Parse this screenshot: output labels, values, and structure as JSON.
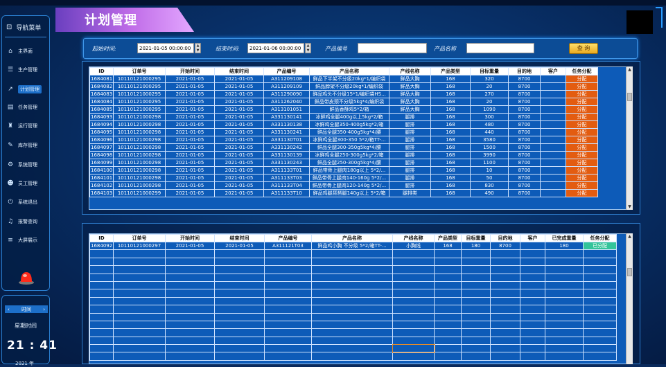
{
  "page": {
    "title": "计划管理"
  },
  "sidebar": {
    "header": "导航菜单",
    "items": [
      {
        "label": "主界面",
        "icon": "home-icon",
        "glyph": "⌂"
      },
      {
        "label": "生产管理",
        "icon": "list-icon",
        "glyph": "☰"
      },
      {
        "label": "计划管理",
        "icon": "chart-icon",
        "glyph": "↗",
        "active": true
      },
      {
        "label": "任务管理",
        "icon": "document-icon",
        "glyph": "▤"
      },
      {
        "label": "运行管理",
        "icon": "network-icon",
        "glyph": "♜"
      },
      {
        "label": "库存管理",
        "icon": "edit-icon",
        "glyph": "✎"
      },
      {
        "label": "系统管理",
        "icon": "gear-icon",
        "glyph": "⚙"
      },
      {
        "label": "员工管理",
        "icon": "user-card-icon",
        "glyph": "☻"
      },
      {
        "label": "系统退出",
        "icon": "power-icon",
        "glyph": "⏻"
      },
      {
        "label": "报警查询",
        "icon": "bell-icon",
        "glyph": "♫"
      },
      {
        "label": "大屏展示",
        "icon": "menu-icon",
        "glyph": "≡"
      }
    ]
  },
  "time_panel": {
    "header": "时间",
    "weekday": "星期时间",
    "clock": "21 : 41",
    "year": "2021 年"
  },
  "filter": {
    "start_label": "起始时间:",
    "start_value": "2021-01-05 00:00:00",
    "end_label": "结束时间:",
    "end_value": "2021-01-06 00:00:00",
    "code_label": "产品编号",
    "code_value": "",
    "name_label": "产品名称",
    "name_value": "",
    "query_label": "查 询"
  },
  "plan_table": {
    "columns": [
      "ID",
      "订单号",
      "开始时间",
      "结束时间",
      "产品编号",
      "产品名称",
      "产线名称",
      "产品类型",
      "目标重量",
      "目的地",
      "客户",
      "任务分配"
    ],
    "rows": [
      [
        "1684081",
        "10110121000295",
        "2021-01-05",
        "2021-01-05",
        "A311209108",
        "鲜品下半架不分级20kg*1/编织袋",
        "鲜品大胸",
        "168",
        "320",
        "8700",
        "",
        "分配"
      ],
      [
        "1684082",
        "10110121000295",
        "2021-01-05",
        "2021-01-05",
        "A311209109",
        "鲜品脖架不分级20kg*1/编织袋",
        "鲜品大胸",
        "168",
        "20",
        "8700",
        "",
        "分配"
      ],
      [
        "1684083",
        "10110121000295",
        "2021-01-05",
        "2021-01-05",
        "A311290090",
        "鲜品鸡头不分级15*1/编织袋HS...",
        "鲜品大胸",
        "168",
        "270",
        "8700",
        "",
        "分配"
      ],
      [
        "1684084",
        "10110121000295",
        "2021-01-05",
        "2021-01-05",
        "A311262040",
        "鲜品带皮颈不分级5kg*4/编织袋",
        "鲜品大胸",
        "168",
        "20",
        "8700",
        "",
        "分配"
      ],
      [
        "1684085",
        "10110121000295",
        "2021-01-05",
        "2021-01-05",
        "A313101051",
        "鲜品香酥鸡5*2/箱",
        "鲜品大胸",
        "168",
        "1090",
        "8700",
        "",
        "分配"
      ],
      [
        "1684093",
        "10110121000298",
        "2021-01-05",
        "2021-01-05",
        "A331130141",
        "冰鲜鸡全腿400g以上5kg*2/箱",
        "腿排",
        "168",
        "300",
        "8700",
        "",
        "分配"
      ],
      [
        "1684094",
        "10110121000298",
        "2021-01-05",
        "2021-01-05",
        "A331130138",
        "冰鲜鸡全腿350-400g5kg*2/箱",
        "腿排",
        "168",
        "480",
        "8700",
        "",
        "分配"
      ],
      [
        "1684095",
        "10110121000298",
        "2021-01-05",
        "2021-01-05",
        "A331130241",
        "鲜品全腿350-400g5kg*4/腰",
        "腿排",
        "168",
        "440",
        "8700",
        "",
        "分配"
      ],
      [
        "1684096",
        "10110121000298",
        "2021-01-05",
        "2021-01-05",
        "A331130T01",
        "冰鲜鸡全腿300-350 5*2/箱TT-...",
        "腿排",
        "168",
        "3580",
        "8700",
        "",
        "分配"
      ],
      [
        "1684097",
        "10110121000298",
        "2021-01-05",
        "2021-01-05",
        "A331130242",
        "鲜品全腿300-350g5kg*4/腰",
        "腿排",
        "168",
        "1500",
        "8700",
        "",
        "分配"
      ],
      [
        "1684098",
        "10110121000298",
        "2021-01-05",
        "2021-01-05",
        "A331130139",
        "冰鲜鸡全腿250-300g5kg*2/箱",
        "腿排",
        "168",
        "3990",
        "8700",
        "",
        "分配"
      ],
      [
        "1684099",
        "10110121000298",
        "2021-01-05",
        "2021-01-05",
        "A331130243",
        "鲜品全腿250-300g5kg*4/腰",
        "腿排",
        "168",
        "1100",
        "8700",
        "",
        "分配"
      ],
      [
        "1684100",
        "10110121000298",
        "2021-01-05",
        "2021-01-05",
        "A311133T01",
        "鲜品带骨上腿肉180g以上 5*2/...",
        "腿排",
        "168",
        "10",
        "8700",
        "",
        "分配"
      ],
      [
        "1684101",
        "10110121000298",
        "2021-01-05",
        "2021-01-05",
        "A311133T03",
        "鲜品带骨上腿肉140-160g 5*2/...",
        "腿排",
        "168",
        "50",
        "8700",
        "",
        "分配"
      ],
      [
        "1684102",
        "10110121000298",
        "2021-01-05",
        "2021-01-05",
        "A311133T04",
        "鲜品带骨上腿肉120-140g 5*2/...",
        "腿排",
        "168",
        "830",
        "8700",
        "",
        "分配"
      ],
      [
        "1684103",
        "10110121000299",
        "2021-01-05",
        "2021-01-05",
        "A311133T10",
        "鲜品鸡腿琵琶腿140g以上 5*2/箱",
        "腿排类",
        "168",
        "490",
        "8700",
        "",
        "分配"
      ]
    ]
  },
  "assigned_table": {
    "columns": [
      "ID",
      "订单号",
      "开始时间",
      "结束时间",
      "产品编号",
      "产品名称",
      "产线名称",
      "产品类型",
      "目标重量",
      "目的地",
      "客户",
      "已完成重量",
      "任务分配"
    ],
    "rows": [
      [
        "1684092",
        "10110121000297",
        "2021-01-05",
        "2021-01-05",
        "A311121T03",
        "鲜品鸡小胸 不分级 5*2/箱TT-...",
        "小胸线",
        "168",
        "180",
        "8700",
        "",
        "180",
        "已分配"
      ]
    ],
    "empty_rows": 14
  }
}
